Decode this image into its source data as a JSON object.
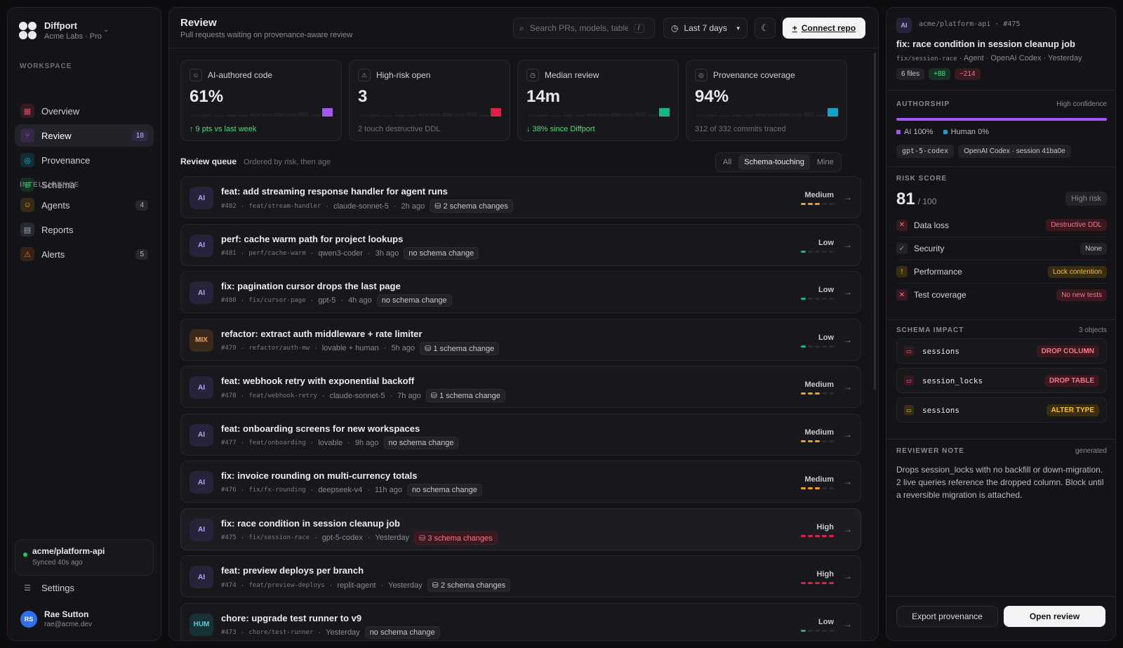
{
  "brand": {
    "name": "Diffport",
    "sub": "Acme Labs · Pro"
  },
  "sidebar": {
    "workspace_label": "WORKSPACE",
    "intelligence_label": "INTELLIGENCE",
    "workspace": [
      {
        "label": "Overview",
        "badge": "",
        "icon": "grid-icon",
        "color": "#f43f5e"
      },
      {
        "label": "Review",
        "badge": "18",
        "icon": "pull-request-icon",
        "color": "#a855f7"
      },
      {
        "label": "Provenance",
        "badge": "",
        "icon": "scan-icon",
        "color": "#06b6d4"
      },
      {
        "label": "Schema",
        "badge": "",
        "icon": "database-icon",
        "color": "#22c55e"
      }
    ],
    "intelligence": [
      {
        "label": "Agents",
        "badge": "4",
        "icon": "bot-icon",
        "color": "#f59e0b"
      },
      {
        "label": "Reports",
        "badge": "",
        "icon": "file-icon",
        "color": "#9ca3af"
      },
      {
        "label": "Alerts",
        "badge": "5",
        "icon": "warning-icon",
        "color": "#f97316"
      }
    ],
    "repo": {
      "name": "acme/platform-api",
      "sync": "Synced 40s ago"
    },
    "settings_label": "Settings",
    "user": {
      "initials": "RS",
      "name": "Rae Sutton",
      "email": "rae@acme.dev"
    }
  },
  "header": {
    "title": "Review",
    "subtitle": "Pull requests waiting on provenance-aware review",
    "search_placeholder": "Search PRs, models, tables",
    "search_kbd": "/",
    "range": "Last 7 days",
    "connect": "Connect repo"
  },
  "stats": [
    {
      "label": "AI-authored code",
      "value": "61%",
      "foot": "↑ 9 pts vs last week",
      "foot_color": "#4ade80",
      "accent": "#a855f7",
      "icon": "bot-icon"
    },
    {
      "label": "High-risk open",
      "value": "3",
      "foot": "2 touch destructive DDL",
      "foot_color": "#6f6f7a",
      "accent": "#e11d48",
      "icon": "warning-icon"
    },
    {
      "label": "Median review",
      "value": "14m",
      "foot": "↓ 38% since Diffport",
      "foot_color": "#4ade80",
      "accent": "#10b981",
      "icon": "clock-icon"
    },
    {
      "label": "Provenance coverage",
      "value": "94%",
      "foot": "312 of 332 commits traced",
      "foot_color": "#6f6f7a",
      "accent": "#0ea5c6",
      "icon": "scan-icon"
    }
  ],
  "queue": {
    "title": "Review queue",
    "subtitle": "Ordered by risk, then age",
    "filters": [
      "All",
      "Schema-touching",
      "Mine"
    ],
    "active_filter": "Schema-touching",
    "rows": [
      {
        "badge": "AI",
        "kind": "ai",
        "title": "feat: add streaming response handler for agent runs",
        "num": "#482",
        "branch": "feat/stream-handler",
        "model": "claude-sonnet-5",
        "age": "2h ago",
        "schema": "2 schema changes",
        "schema_icon": true,
        "schema_red": false,
        "risk": "Medium",
        "level": 3,
        "risk_color": "#f59e0b"
      },
      {
        "badge": "AI",
        "kind": "ai",
        "title": "perf: cache warm path for project lookups",
        "num": "#481",
        "branch": "perf/cache-warm",
        "model": "qwen3-coder",
        "age": "3h ago",
        "schema": "no schema change",
        "schema_icon": false,
        "schema_red": false,
        "risk": "Low",
        "level": 1,
        "risk_color": "#10b981"
      },
      {
        "badge": "AI",
        "kind": "ai",
        "title": "fix: pagination cursor drops the last page",
        "num": "#480",
        "branch": "fix/cursor-page",
        "model": "gpt-5",
        "age": "4h ago",
        "schema": "no schema change",
        "schema_icon": false,
        "schema_red": false,
        "risk": "Low",
        "level": 1,
        "risk_color": "#10b981"
      },
      {
        "badge": "MIX",
        "kind": "mix",
        "title": "refactor: extract auth middleware + rate limiter",
        "num": "#479",
        "branch": "refactor/auth-mw",
        "model": "lovable + human",
        "age": "5h ago",
        "schema": "1 schema change",
        "schema_icon": true,
        "schema_red": false,
        "risk": "Low",
        "level": 1,
        "risk_color": "#10b981"
      },
      {
        "badge": "AI",
        "kind": "ai",
        "title": "feat: webhook retry with exponential backoff",
        "num": "#478",
        "branch": "feat/webhook-retry",
        "model": "claude-sonnet-5",
        "age": "7h ago",
        "schema": "1 schema change",
        "schema_icon": true,
        "schema_red": false,
        "risk": "Medium",
        "level": 3,
        "risk_color": "#f59e0b"
      },
      {
        "badge": "AI",
        "kind": "ai",
        "title": "feat: onboarding screens for new workspaces",
        "num": "#477",
        "branch": "feat/onboarding",
        "model": "lovable",
        "age": "9h ago",
        "schema": "no schema change",
        "schema_icon": false,
        "schema_red": false,
        "risk": "Medium",
        "level": 3,
        "risk_color": "#f59e0b"
      },
      {
        "badge": "AI",
        "kind": "ai",
        "title": "fix: invoice rounding on multi-currency totals",
        "num": "#476",
        "branch": "fix/fx-rounding",
        "model": "deepseek-v4",
        "age": "11h ago",
        "schema": "no schema change",
        "schema_icon": false,
        "schema_red": false,
        "risk": "Medium",
        "level": 3,
        "risk_color": "#f59e0b"
      },
      {
        "badge": "AI",
        "kind": "ai",
        "title": "fix: race condition in session cleanup job",
        "num": "#475",
        "branch": "fix/session-race",
        "model": "gpt-5-codex",
        "age": "Yesterday",
        "schema": "3 schema changes",
        "schema_icon": true,
        "schema_red": true,
        "risk": "High",
        "level": 5,
        "risk_color": "#e11d48"
      },
      {
        "badge": "AI",
        "kind": "ai",
        "title": "feat: preview deploys per branch",
        "num": "#474",
        "branch": "feat/preview-deploys",
        "model": "replit-agent",
        "age": "Yesterday",
        "schema": "2 schema changes",
        "schema_icon": true,
        "schema_red": false,
        "risk": "High",
        "level": 5,
        "risk_color": "#e11d48"
      },
      {
        "badge": "HUM",
        "kind": "hum",
        "title": "chore: upgrade test runner to v9",
        "num": "#473",
        "branch": "chore/test-runner",
        "model": "",
        "age": "Yesterday",
        "schema": "no schema change",
        "schema_icon": false,
        "schema_red": false,
        "risk": "Low",
        "level": 1,
        "risk_color": "#10b981"
      }
    ]
  },
  "detail": {
    "badge": "AI",
    "repo": "acme/platform-api",
    "num": "#475",
    "title": "fix: race condition in session cleanup job",
    "branch": "fix/session-race",
    "agent": "Agent · OpenAI Codex",
    "age": "Yesterday",
    "files": "6 files",
    "additions": "+88",
    "deletions": "−214",
    "authorship": {
      "label": "AUTHORSHIP",
      "confidence": "High confidence",
      "ai_label": "AI 100%",
      "human_label": "Human 0%",
      "ai_fraction": 1.0,
      "model_tag": "gpt-5-codex",
      "session_tag": "OpenAI Codex · session 41ba0e"
    },
    "risk": {
      "label": "RISK SCORE",
      "score": "81",
      "max": "/ 100",
      "level": "High risk",
      "items": [
        {
          "label": "Data loss",
          "tag": "Destructive DDL",
          "status": "fail"
        },
        {
          "label": "Security",
          "tag": "None",
          "status": "pass"
        },
        {
          "label": "Performance",
          "tag": "Lock contention",
          "status": "warn"
        },
        {
          "label": "Test coverage",
          "tag": "No new tests",
          "status": "fail"
        }
      ]
    },
    "schema": {
      "label": "SCHEMA IMPACT",
      "count": "3 objects",
      "objects": [
        {
          "name": "sessions",
          "op": "DROP COLUMN",
          "severity": "danger"
        },
        {
          "name": "session_locks",
          "op": "DROP TABLE",
          "severity": "danger"
        },
        {
          "name": "sessions",
          "op": "ALTER TYPE",
          "severity": "warn"
        }
      ]
    },
    "note": {
      "label": "REVIEWER NOTE",
      "tag": "generated",
      "text": "Drops session_locks with no backfill or down-migration. 2 live queries reference the dropped column. Block until a reversible migration is attached."
    },
    "export_label": "Export provenance",
    "open_label": "Open review"
  }
}
